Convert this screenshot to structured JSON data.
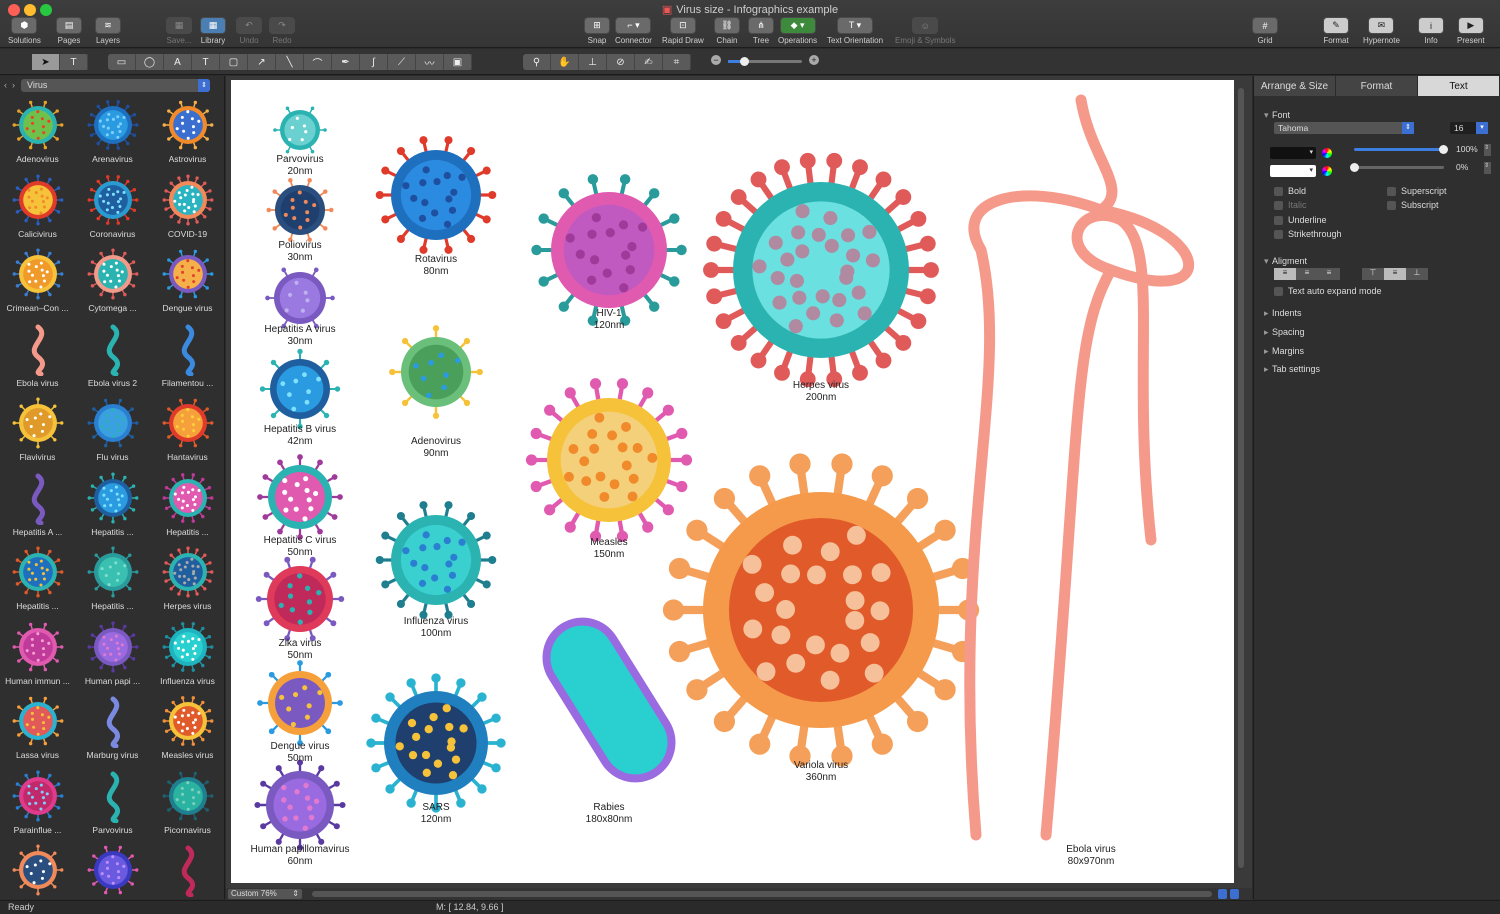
{
  "window": {
    "title": "Virus size - Infographics example"
  },
  "toolbar": {
    "solutions": "Solutions",
    "pages": "Pages",
    "layers": "Layers",
    "save": "Save...",
    "library": "Library",
    "undo": "Undo",
    "redo": "Redo",
    "snap": "Snap",
    "connector": "Connector",
    "rapid_draw": "Rapid Draw",
    "chain": "Chain",
    "tree": "Tree",
    "operations": "Operations",
    "text_orientation": "Text Orientation",
    "emoji": "Emoji & Symbols",
    "grid": "Grid",
    "format": "Format",
    "hypernote": "Hypernote",
    "info": "Info",
    "present": "Present"
  },
  "library": {
    "category": "Virus",
    "items": [
      "Adenovirus",
      "Arenavirus",
      "Astrovirus",
      "Calicivirus",
      "Coronavirus",
      "COVID-19",
      "Crimean–Con ...",
      "Cytomega ...",
      "Dengue virus",
      "Ebola virus",
      "Ebola virus 2",
      "Filamentou ...",
      "Flavivirus",
      "Flu virus",
      "Hantavirus",
      "Hepatitis A ...",
      "Hepatitis ...",
      "Hepatitis ...",
      "Hepatitis ...",
      "Hepatitis ...",
      "Herpes virus",
      "Human immun ...",
      "Human papi ...",
      "Influenza virus",
      "Lassa virus",
      "Marburg virus",
      "Measles virus",
      "Parainflue ...",
      "Parvovirus",
      "Picornavirus",
      "",
      "",
      ""
    ]
  },
  "canvas": {
    "labels": [
      {
        "name": "Parvovirus",
        "size": "20nm"
      },
      {
        "name": "Poliovirus",
        "size": "30nm"
      },
      {
        "name": "Hepatitis A virus",
        "size": "30nm"
      },
      {
        "name": "Hepatitis B virus",
        "size": "42nm"
      },
      {
        "name": "Hepatitis C virus",
        "size": "50nm"
      },
      {
        "name": "Zika virus",
        "size": "50nm"
      },
      {
        "name": "Dengue virus",
        "size": "50nm"
      },
      {
        "name": "Human papillomavirus",
        "size": "60nm"
      },
      {
        "name": "Rotavirus",
        "size": "80nm"
      },
      {
        "name": "Adenovirus",
        "size": "90nm"
      },
      {
        "name": "Influenza virus",
        "size": "100nm"
      },
      {
        "name": "SARS",
        "size": "120nm"
      },
      {
        "name": "HIV-1",
        "size": "120nm"
      },
      {
        "name": "Measles",
        "size": "150nm"
      },
      {
        "name": "Rabies",
        "size": "180x80nm"
      },
      {
        "name": "Herpes virus",
        "size": "200nm"
      },
      {
        "name": "Variola virus",
        "size": "360nm"
      },
      {
        "name": "Ebola virus",
        "size": "80x970nm"
      }
    ]
  },
  "view": {
    "zoom": "Custom 76%"
  },
  "status": {
    "text": "Ready",
    "mouse": "M: [ 12.84, 9.66 ]"
  },
  "panel": {
    "tabs": [
      "Arrange & Size",
      "Format",
      "Text"
    ],
    "font_section": "Font",
    "font_name": "Tahoma",
    "font_size": "16",
    "opacity1": "100%",
    "opacity2": "0%",
    "bold": "Bold",
    "italic": "Italic",
    "underline": "Underline",
    "strikethrough": "Strikethrough",
    "superscript": "Superscript",
    "subscript": "Subscript",
    "alignment_section": "Aligment",
    "auto_expand": "Text auto expand mode",
    "indents": "Indents",
    "spacing": "Spacing",
    "margins": "Margins",
    "tab_settings": "Tab settings"
  }
}
